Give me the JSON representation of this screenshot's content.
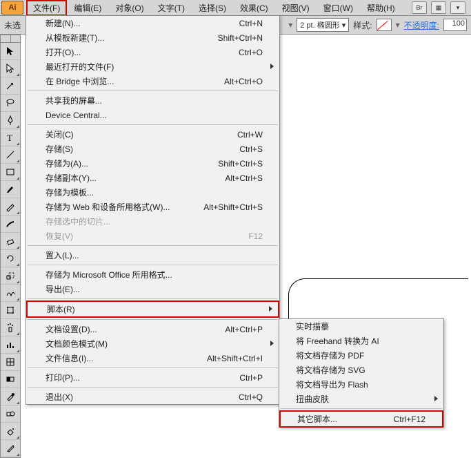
{
  "app_badge": "Ai",
  "menubar": {
    "items": [
      {
        "label": "文件(F)",
        "active": true
      },
      {
        "label": "编辑(E)"
      },
      {
        "label": "对象(O)"
      },
      {
        "label": "文字(T)"
      },
      {
        "label": "选择(S)"
      },
      {
        "label": "效果(C)"
      },
      {
        "label": "视图(V)"
      },
      {
        "label": "窗口(W)"
      },
      {
        "label": "帮助(H)"
      }
    ],
    "right_btn1": "Br",
    "right_btn2": "▦"
  },
  "optionsbar": {
    "left_text": "未选",
    "stroke_size": "2 pt.",
    "stroke_shape": "椭圆形",
    "style_label": "样式:",
    "opacity_label": "不透明度:",
    "opacity_value": "100"
  },
  "file_menu": [
    {
      "label": "新建(N)...",
      "shortcut": "Ctrl+N"
    },
    {
      "label": "从模板新建(T)...",
      "shortcut": "Shift+Ctrl+N"
    },
    {
      "label": "打开(O)...",
      "shortcut": "Ctrl+O"
    },
    {
      "label": "最近打开的文件(F)",
      "submenu": true
    },
    {
      "label": "在 Bridge 中浏览...",
      "shortcut": "Alt+Ctrl+O"
    },
    {
      "sep": true
    },
    {
      "label": "共享我的屏幕..."
    },
    {
      "label": "Device Central..."
    },
    {
      "sep": true
    },
    {
      "label": "关闭(C)",
      "shortcut": "Ctrl+W"
    },
    {
      "label": "存储(S)",
      "shortcut": "Ctrl+S"
    },
    {
      "label": "存储为(A)...",
      "shortcut": "Shift+Ctrl+S"
    },
    {
      "label": "存储副本(Y)...",
      "shortcut": "Alt+Ctrl+S"
    },
    {
      "label": "存储为模板..."
    },
    {
      "label": "存储为 Web 和设备所用格式(W)...",
      "shortcut": "Alt+Shift+Ctrl+S"
    },
    {
      "label": "存储选中的切片...",
      "disabled": true
    },
    {
      "label": "恢复(V)",
      "shortcut": "F12",
      "disabled": true
    },
    {
      "sep": true
    },
    {
      "label": "置入(L)..."
    },
    {
      "sep": true
    },
    {
      "label": "存储为 Microsoft Office 所用格式..."
    },
    {
      "label": "导出(E)..."
    },
    {
      "sep": true
    },
    {
      "label": "脚本(R)",
      "submenu": true,
      "highlight": true
    },
    {
      "sep": true
    },
    {
      "label": "文档设置(D)...",
      "shortcut": "Alt+Ctrl+P"
    },
    {
      "label": "文档颜色模式(M)",
      "submenu": true
    },
    {
      "label": "文件信息(I)...",
      "shortcut": "Alt+Shift+Ctrl+I"
    },
    {
      "sep": true
    },
    {
      "label": "打印(P)...",
      "shortcut": "Ctrl+P"
    },
    {
      "sep": true
    },
    {
      "label": "退出(X)",
      "shortcut": "Ctrl+Q"
    }
  ],
  "script_submenu": [
    {
      "label": "实时描摹"
    },
    {
      "label": "将 Freehand 转换为 AI"
    },
    {
      "label": "将文档存储为 PDF"
    },
    {
      "label": "将文档存储为 SVG"
    },
    {
      "label": "将文档导出为 Flash"
    },
    {
      "label": "扭曲皮肤",
      "submenu": true
    },
    {
      "sep": true
    },
    {
      "label": "其它脚本...",
      "shortcut": "Ctrl+F12",
      "highlight": true
    }
  ],
  "tools": [
    "selection",
    "direct-selection",
    "magic-wand",
    "lasso",
    "pen",
    "type",
    "line",
    "rectangle",
    "paintbrush",
    "pencil",
    "blob-brush",
    "eraser",
    "rotate",
    "scale",
    "warp",
    "free-transform",
    "symbol-sprayer",
    "graph",
    "mesh",
    "gradient",
    "eyedropper",
    "blend",
    "live-paint",
    "slice"
  ]
}
